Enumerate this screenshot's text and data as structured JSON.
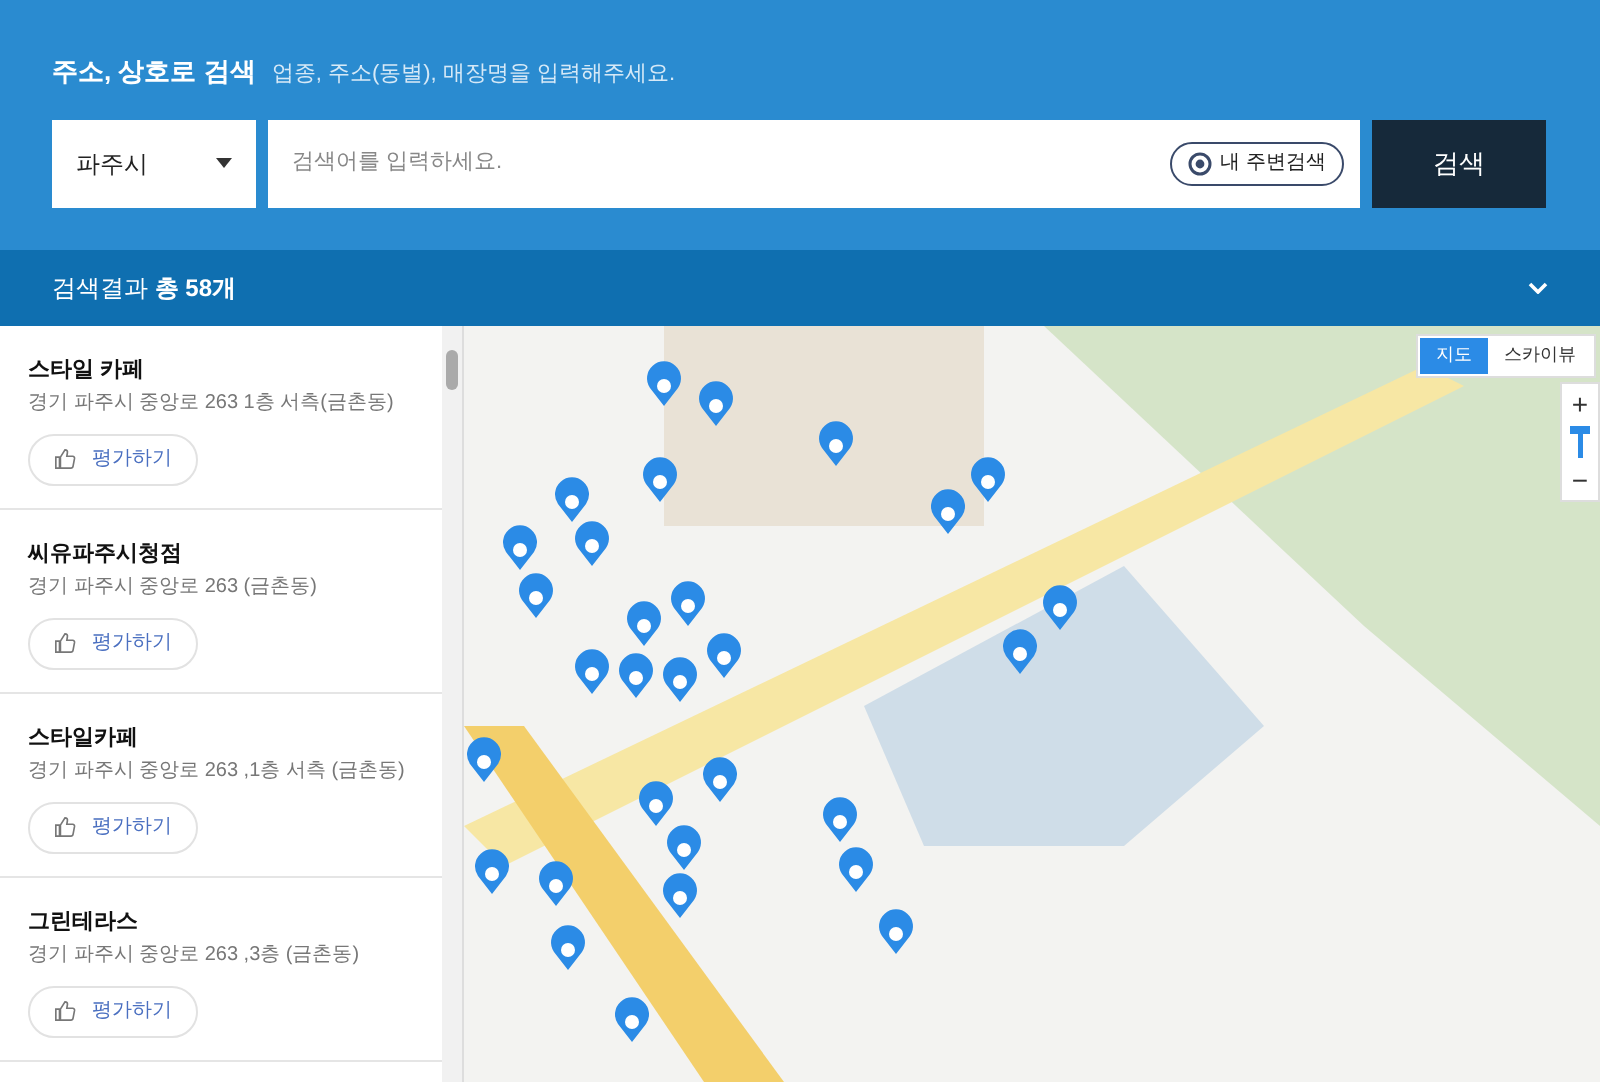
{
  "search_header": {
    "title": "주소, 상호로 검색",
    "hint": "업종, 주소(동별), 매장명을 입력해주세요.",
    "region_select": {
      "value": "파주시"
    },
    "search_field": {
      "placeholder": "검색어를 입력하세요."
    },
    "nearby_button": "내 주변검색",
    "search_button": "검색"
  },
  "results_bar": {
    "label": "검색결과",
    "count": "총 58개"
  },
  "results": [
    {
      "name": "스타일 카페",
      "address": "경기 파주시 중앙로 263 1층 서측(금촌동)",
      "rate_button": "평가하기"
    },
    {
      "name": "씨유파주시청점",
      "address": "경기 파주시 중앙로 263 (금촌동)",
      "rate_button": "평가하기"
    },
    {
      "name": "스타일카페",
      "address": "경기 파주시 중앙로 263 ,1층 서측 (금촌동)",
      "rate_button": "평가하기"
    },
    {
      "name": "그린테라스",
      "address": "경기 파주시 중앙로 263 ,3층 (금촌동)",
      "rate_button": "평가하기"
    }
  ],
  "map_type_tabs": [
    {
      "label": "지도",
      "selected": true
    },
    {
      "label": "스카이뷰",
      "selected": false
    }
  ],
  "zoom_controls": {
    "zoom_in": "+",
    "zoom_out": "−"
  }
}
